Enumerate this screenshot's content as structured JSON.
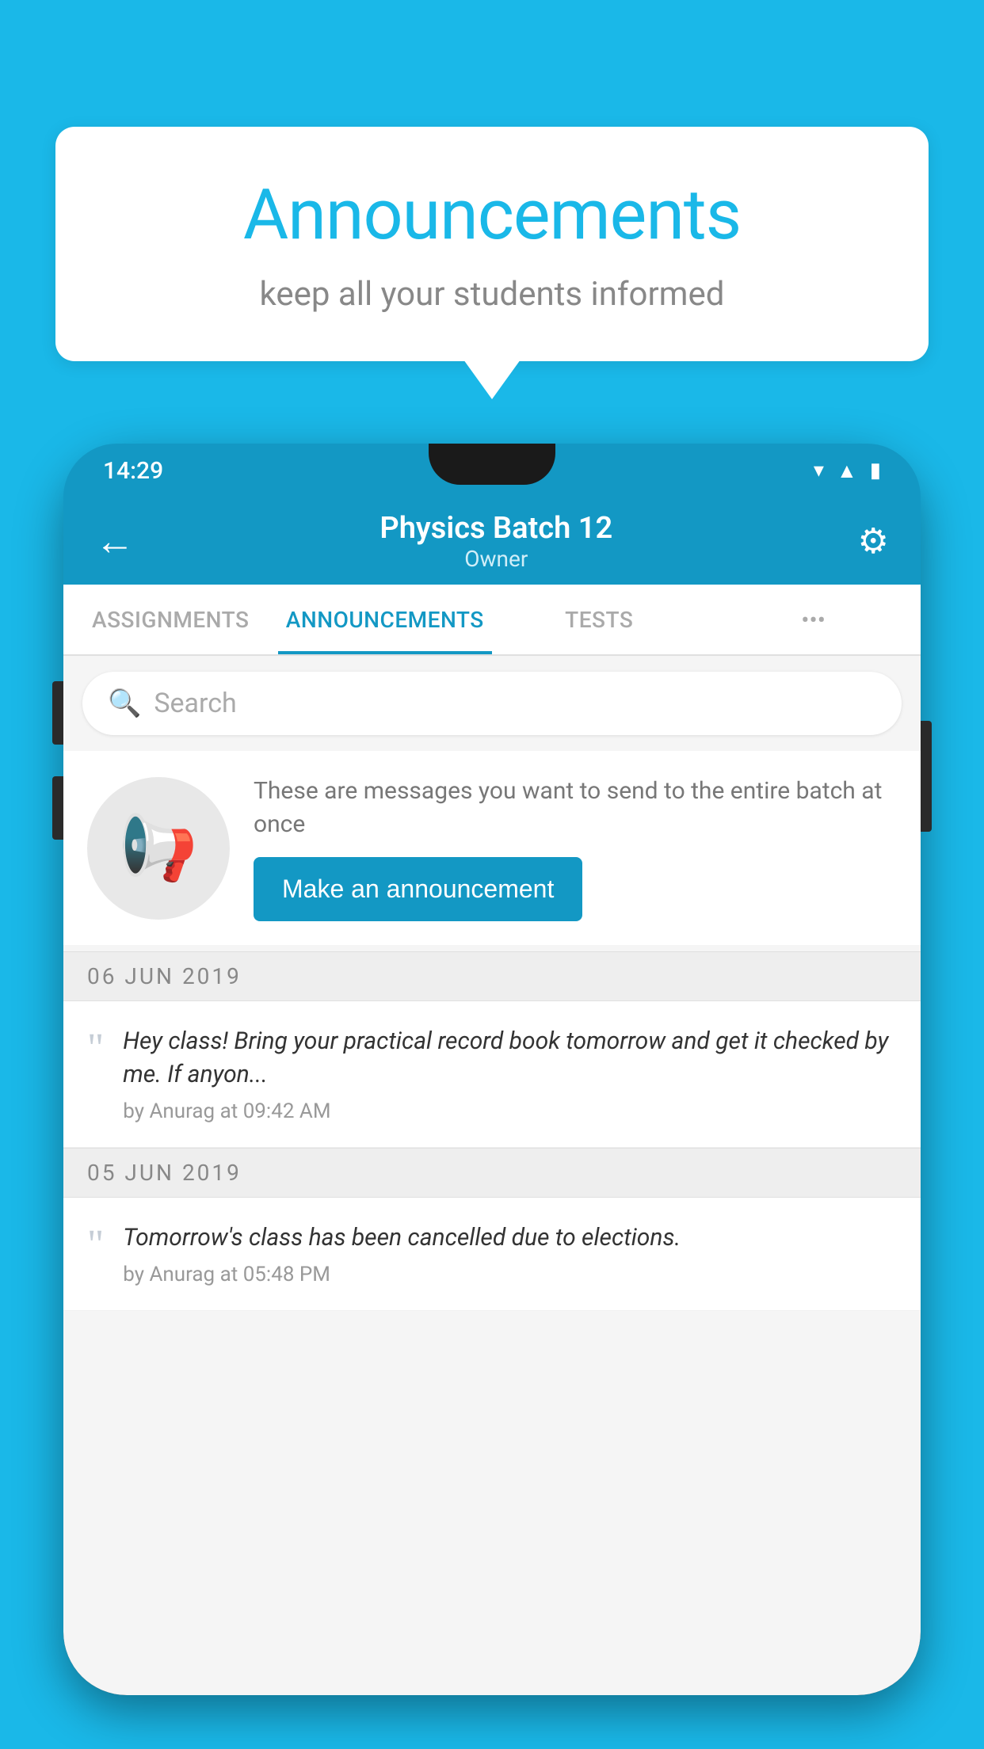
{
  "background_color": "#1ab8e8",
  "speech_bubble": {
    "title": "Announcements",
    "subtitle": "keep all your students informed"
  },
  "phone": {
    "status_bar": {
      "time": "14:29",
      "icons": [
        "wifi",
        "signal",
        "battery"
      ]
    },
    "app_bar": {
      "back_label": "←",
      "title": "Physics Batch 12",
      "subtitle": "Owner",
      "settings_label": "⚙"
    },
    "tabs": [
      {
        "label": "ASSIGNMENTS",
        "active": false
      },
      {
        "label": "ANNOUNCEMENTS",
        "active": true
      },
      {
        "label": "TESTS",
        "active": false
      },
      {
        "label": "•••",
        "active": false
      }
    ],
    "search": {
      "placeholder": "Search"
    },
    "cta_card": {
      "description": "These are messages you want to send to the entire batch at once",
      "button_label": "Make an announcement"
    },
    "announcements": [
      {
        "date": "06  JUN  2019",
        "text": "Hey class! Bring your practical record book tomorrow and get it checked by me. If anyon...",
        "meta": "by Anurag at 09:42 AM"
      },
      {
        "date": "05  JUN  2019",
        "text": "Tomorrow's class has been cancelled due to elections.",
        "meta": "by Anurag at 05:48 PM"
      }
    ]
  }
}
